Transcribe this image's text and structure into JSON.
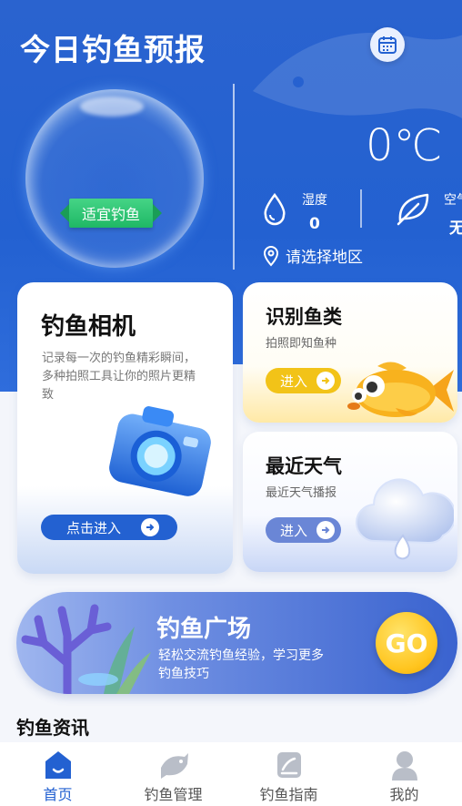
{
  "header": {
    "title": "今日钓鱼预报",
    "badge": "适宜钓鱼",
    "temperature": "0℃",
    "humidity_label": "湿度",
    "humidity_value": "0",
    "air_label": "空气",
    "air_value": "无",
    "region": "请选择地区"
  },
  "cards": {
    "camera": {
      "title": "钓鱼相机",
      "desc": "记录每一次的钓鱼精彩瞬间，多种拍照工具让你的照片更精致",
      "button": "点击进入"
    },
    "fish": {
      "title": "识别鱼类",
      "subtitle": "拍照即知鱼种",
      "button": "进入"
    },
    "weather": {
      "title": "最近天气",
      "subtitle": "最近天气播报",
      "button": "进入"
    }
  },
  "plaza": {
    "title": "钓鱼广场",
    "desc": "轻松交流钓鱼经验，学习更多钓鱼技巧",
    "go": "GO"
  },
  "news": {
    "title": "钓鱼资讯"
  },
  "tabbar": {
    "items": [
      {
        "label": "首页",
        "icon": "home-icon",
        "active": true
      },
      {
        "label": "钓鱼管理",
        "icon": "fish-icon",
        "active": false
      },
      {
        "label": "钓鱼指南",
        "icon": "guide-icon",
        "active": false
      },
      {
        "label": "我的",
        "icon": "user-icon",
        "active": false
      }
    ]
  },
  "colors": {
    "primary": "#2361d1",
    "badge_green": "#1fb865",
    "go_yellow": "#ffc51f"
  }
}
